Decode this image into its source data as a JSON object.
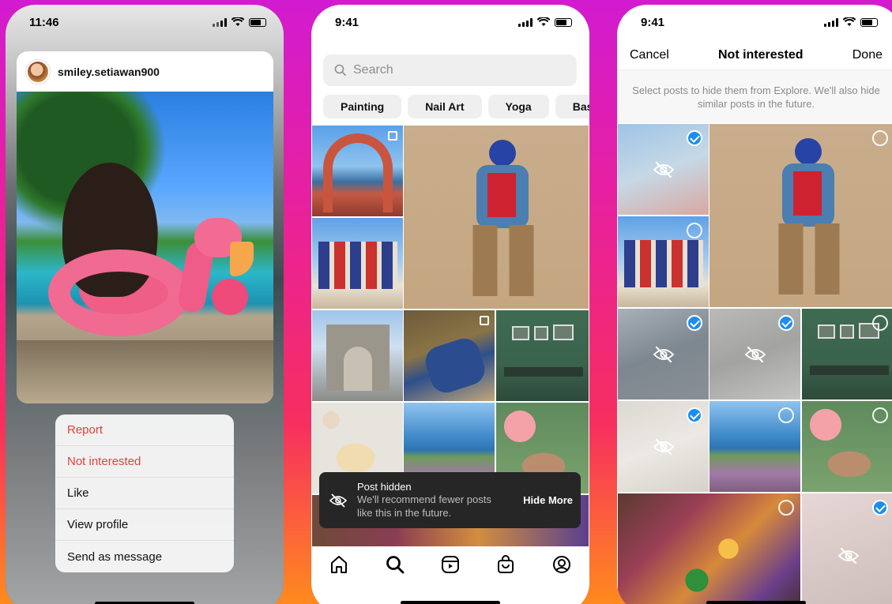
{
  "phone1": {
    "status_time": "11:46",
    "username": "smiley.setiawan900",
    "menu": [
      {
        "label": "Report",
        "danger": true
      },
      {
        "label": "Not interested",
        "danger": true
      },
      {
        "label": "Like",
        "danger": false
      },
      {
        "label": "View profile",
        "danger": false
      },
      {
        "label": "Send as message",
        "danger": false
      }
    ]
  },
  "phone2": {
    "status_time": "9:41",
    "search_placeholder": "Search",
    "chips": [
      "Painting",
      "Nail Art",
      "Yoga",
      "Base"
    ],
    "toast": {
      "title": "Post hidden",
      "body": "We'll recommend fewer posts like this in the future.",
      "action": "Hide More"
    },
    "tabs": [
      "home-icon",
      "search-icon",
      "reels-icon",
      "shop-icon",
      "profile-icon"
    ]
  },
  "phone3": {
    "status_time": "9:41",
    "cancel_label": "Cancel",
    "title": "Not interested",
    "done_label": "Done",
    "hint": "Select posts to hide them from Explore. We'll also hide similar posts in the future."
  },
  "colors": {
    "danger": "#e0433d",
    "selected": "#1c8cf2"
  }
}
